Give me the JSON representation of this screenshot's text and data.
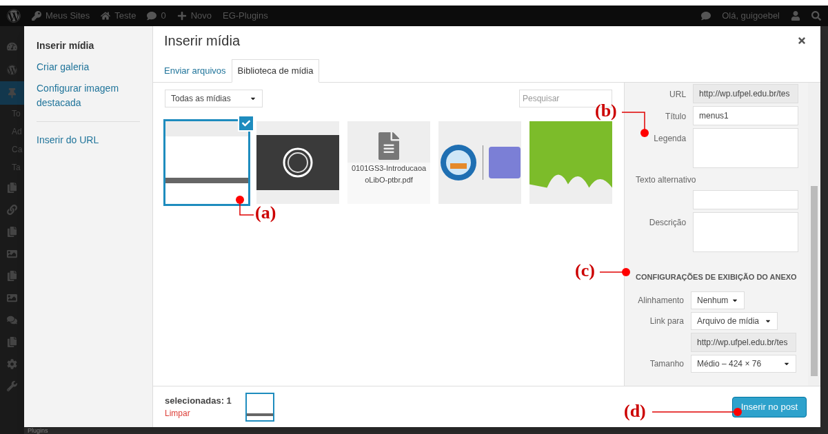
{
  "admin_bar": {
    "left": [
      {
        "kind": "logo"
      },
      {
        "kind": "key",
        "label": "Meus Sites"
      },
      {
        "kind": "home",
        "label": "Teste"
      },
      {
        "kind": "comment",
        "label": "0"
      },
      {
        "kind": "plus",
        "label": "Novo"
      },
      {
        "kind": "text",
        "label": "EG-Plugins"
      }
    ],
    "greeting": "Olá, guigoebel"
  },
  "background_menu": [
    "To",
    "Ad",
    "Ca",
    "Ta"
  ],
  "background_plugins": "Plugins",
  "modal": {
    "menu": [
      {
        "label": "Inserir mídia",
        "selected": true
      },
      {
        "label": "Criar galeria",
        "selected": false
      },
      {
        "label": "Configurar imagem destacada",
        "selected": false
      },
      {
        "label": "Inserir do URL",
        "selected": false
      }
    ],
    "title": "Inserir mídia",
    "tabs": [
      {
        "label": "Enviar arquivos",
        "selected": false
      },
      {
        "label": "Biblioteca de mídia",
        "selected": true
      }
    ],
    "filter": "Todas as mídias",
    "search": {
      "placeholder": "Pesquisar"
    },
    "items": [
      {
        "kind": "screenshot",
        "selected": true
      },
      {
        "kind": "photo",
        "selected": false
      },
      {
        "kind": "file",
        "filename": "0101GS3-IntroducaoaoLibO-ptbr.pdf",
        "selected": false
      },
      {
        "kind": "logo",
        "selected": false
      },
      {
        "kind": "shape",
        "selected": false
      }
    ],
    "details": [
      {
        "kind": "readonly",
        "label": "URL",
        "value": "http://wp.ufpel.edu.br/tes"
      },
      {
        "kind": "input",
        "label": "Título",
        "value": "menus1"
      },
      {
        "kind": "textarea",
        "label": "Legenda"
      },
      {
        "kind": "stacked",
        "label": "Texto alternativo"
      },
      {
        "kind": "textarea",
        "label": "Descrição"
      }
    ],
    "display_heading": "CONFIGURAÇÕES DE EXIBIÇÃO DO ANEXO",
    "settings": [
      {
        "kind": "select",
        "label": "Alinhamento",
        "value": "Nenhum"
      },
      {
        "kind": "select",
        "label": "Link para",
        "value": "Arquivo de mídia"
      },
      {
        "kind": "readonly",
        "value": "http://wp.ufpel.edu.br/tes"
      },
      {
        "kind": "select",
        "label": "Tamanho",
        "value": "Médio – 424 × 76"
      }
    ],
    "selection": {
      "count": "selecionadas: 1",
      "clear": "Limpar"
    },
    "insert_button": "Inserir no post"
  },
  "annotations": [
    "(a)",
    "(b)",
    "(c)",
    "(d)"
  ]
}
